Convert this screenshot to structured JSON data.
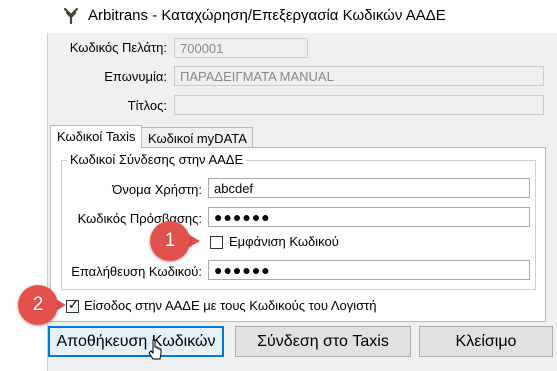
{
  "window": {
    "title": "Arbitrans - Καταχώρηση/Επεξεργασία Κωδικών ΑΑΔΕ",
    "app_icon": "arbitrans-logo-icon"
  },
  "customer": {
    "code_label": "Κωδικός Πελάτη:",
    "code_value": "700001",
    "name_label": "Επωνυμία:",
    "name_value": "ΠΑΡΑΔΕΙΓΜΑΤΑ MANUAL",
    "title_label": "Τίτλος:",
    "title_value": ""
  },
  "tabs": [
    {
      "label": "Κωδικοί Taxis",
      "active": true
    },
    {
      "label": "Κωδικοί myDATA",
      "active": false
    }
  ],
  "taxis": {
    "group_title": "Κωδικοί Σύνδεσης στην ΑΑΔΕ",
    "username_label": "Όνομα Χρήστη:",
    "username_value": "abcdef",
    "password_label": "Κωδικός Πρόσβασης:",
    "password_value": "●●●●●●",
    "show_password_label": "Εμφάνιση Κωδικού",
    "show_password_checked": false,
    "confirm_label": "Επαλήθευση Κωδικού:",
    "confirm_value": "●●●●●●",
    "accountant_login_label": "Είσοδος στην ΑΑΔΕ με τους Κωδικούς του Λογιστή",
    "accountant_login_checked": true
  },
  "buttons": {
    "save": "Αποθήκευση Κωδικών",
    "connect": "Σύνδεση στο Taxis",
    "close": "Κλείσιμο"
  },
  "callouts": [
    {
      "number": "1",
      "color": "#e2514a"
    },
    {
      "number": "2",
      "color": "#e2514a"
    }
  ]
}
